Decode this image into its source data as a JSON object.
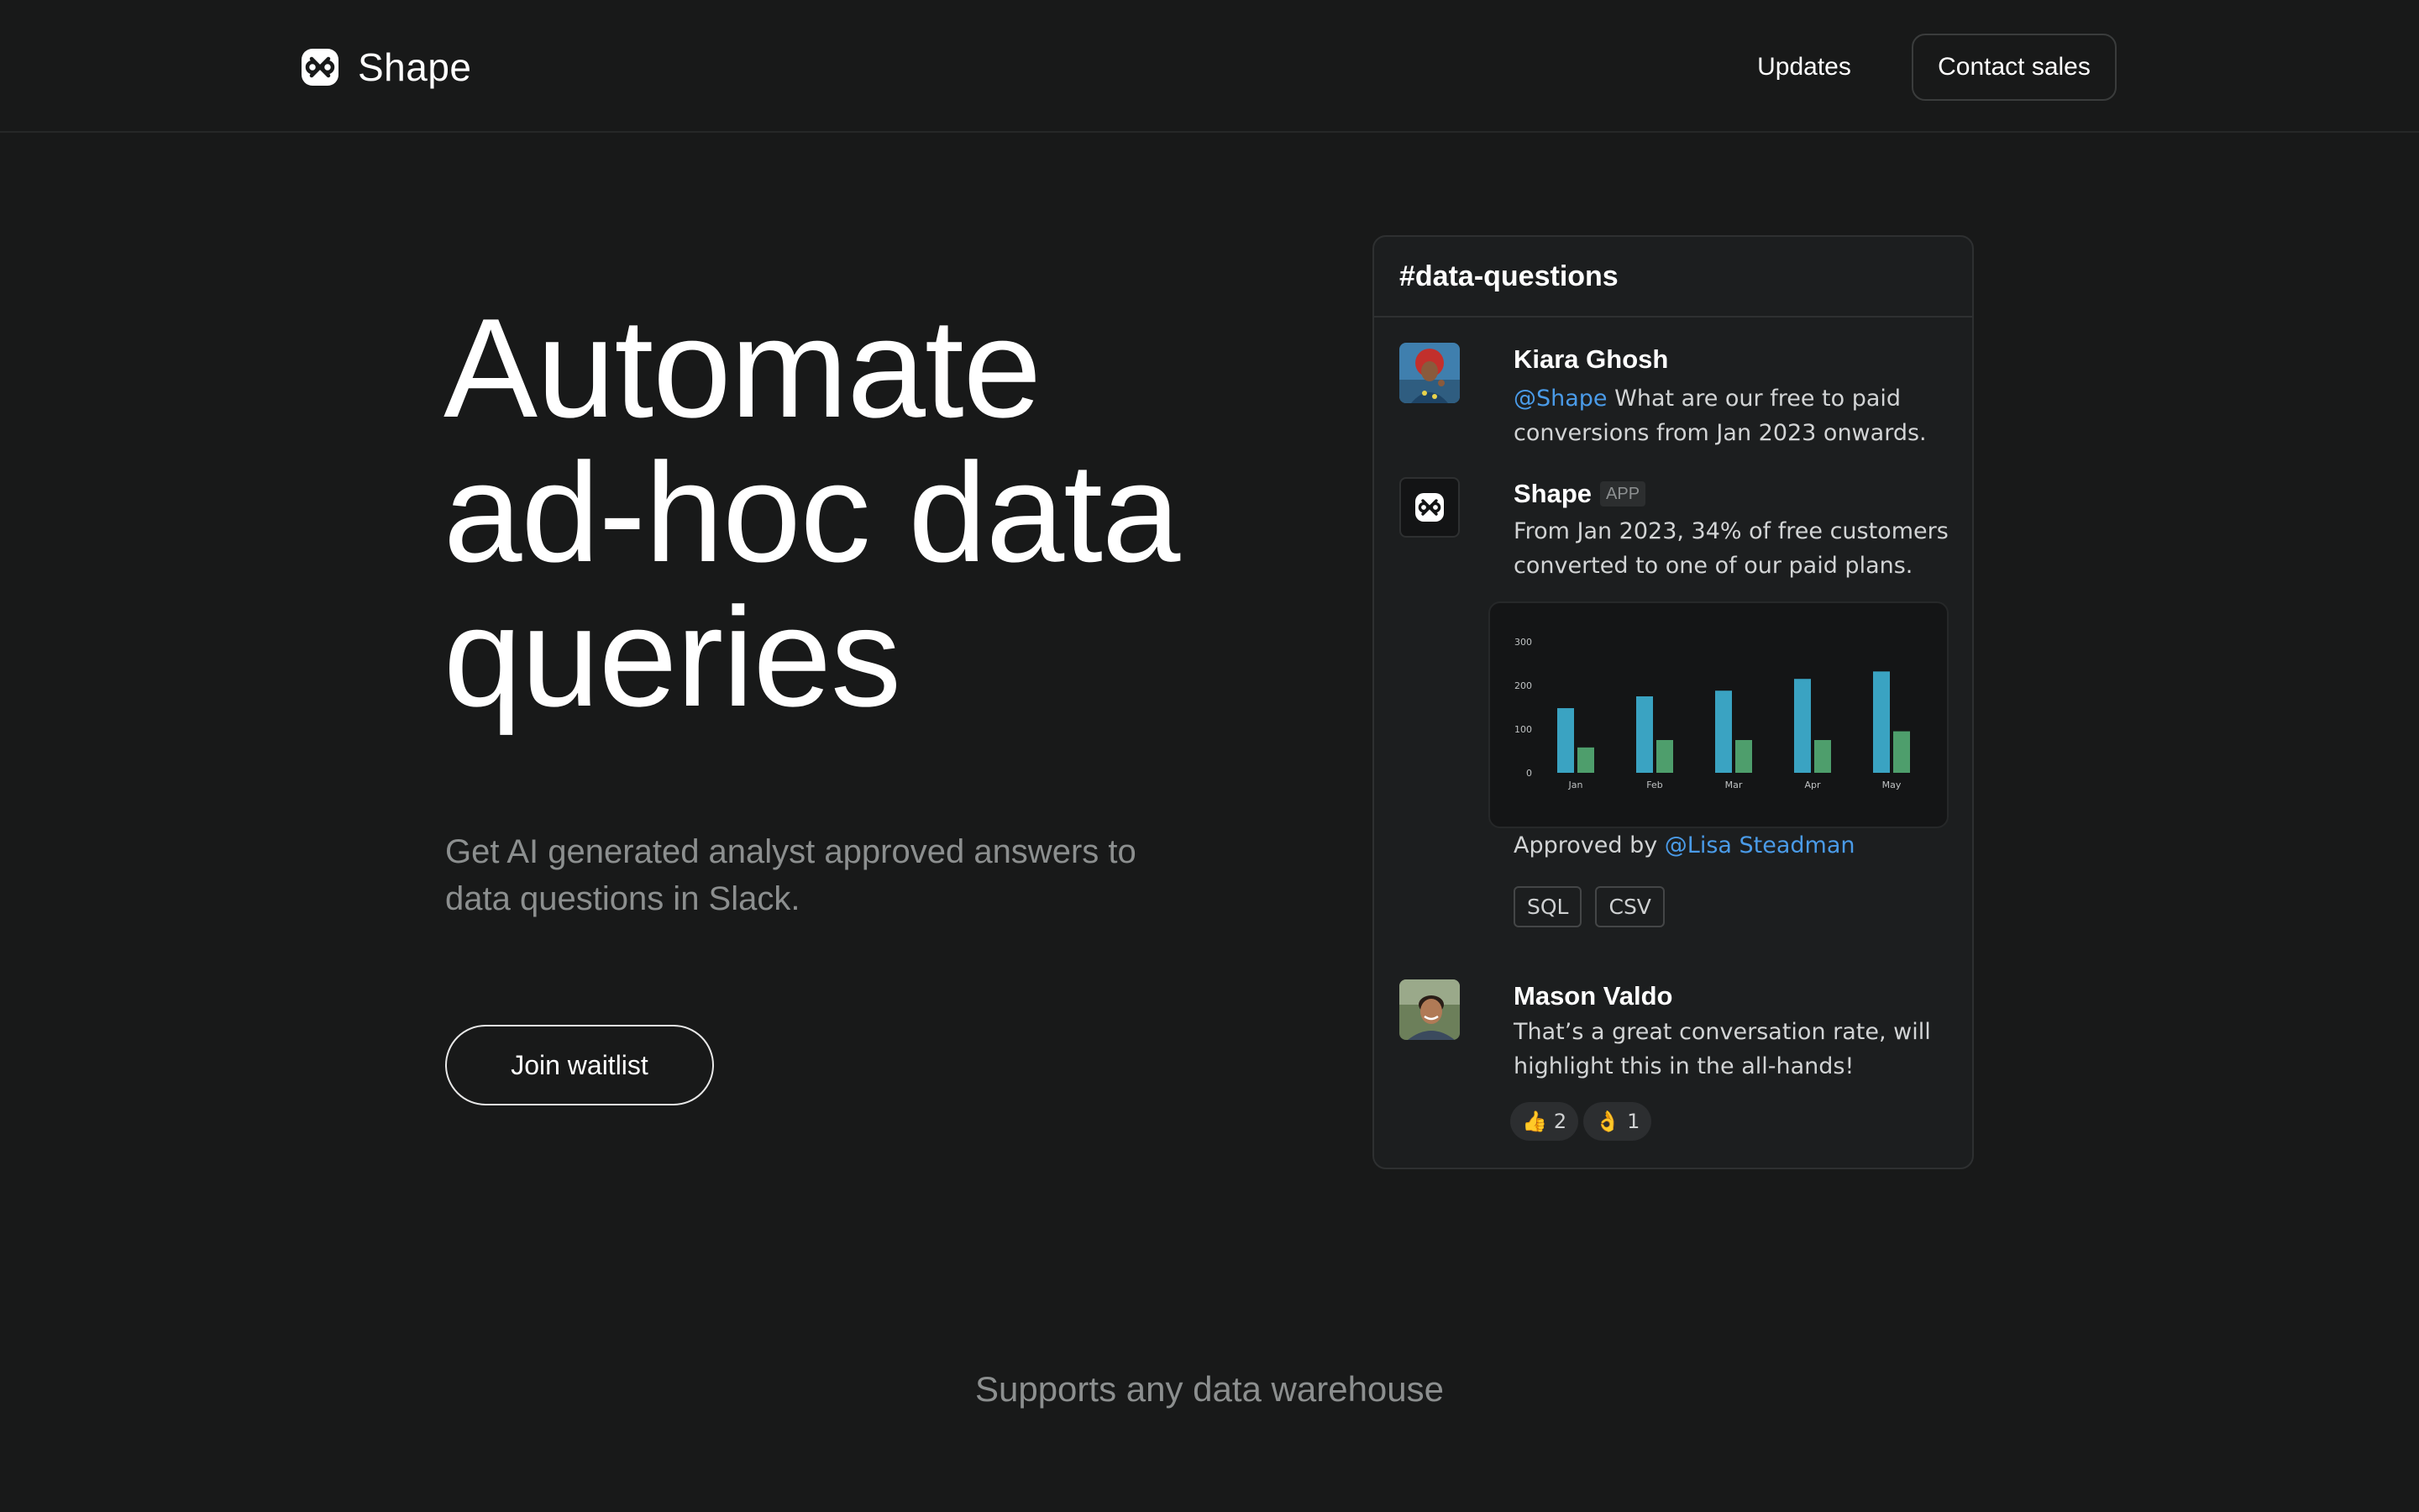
{
  "nav": {
    "brand": "Shape",
    "links": {
      "updates": "Updates"
    },
    "contact_label": "Contact sales"
  },
  "hero": {
    "title_lines": [
      "Automate",
      "ad-hoc data",
      "queries"
    ],
    "subtitle_lines": [
      "Get AI generated analyst approved answers to",
      "data questions in Slack."
    ],
    "cta_label": "Join waitlist"
  },
  "panel": {
    "channel": "#data-questions",
    "messages": [
      {
        "author": "Kiara Ghosh",
        "mention": "@Shape",
        "text_line1": " What are our free to paid",
        "text_line2": "conversions from Jan 2023 onwards."
      },
      {
        "author": "Shape",
        "badge": "APP",
        "text_line1": "From Jan 2023, 34% of free customers",
        "text_line2": "converted to one of our paid plans.",
        "approved_prefix": "Approved by ",
        "approved_mention": "@Lisa Steadman",
        "chips": [
          "SQL",
          "CSV"
        ]
      },
      {
        "author": "Mason Valdo",
        "text_line1": "That’s a great conversation rate, will",
        "text_line2": "highlight this in the all-hands!",
        "reactions": [
          {
            "emoji": "👍",
            "count": "2"
          },
          {
            "emoji": "👌",
            "count": "1"
          }
        ]
      }
    ]
  },
  "chart_data": {
    "type": "bar",
    "categories": [
      "Jan",
      "Feb",
      "Mar",
      "Apr",
      "May"
    ],
    "series": [
      {
        "values": [
          148,
          175,
          188,
          215,
          232
        ],
        "color": "#3aa3c2"
      },
      {
        "values": [
          58,
          75,
          75,
          75,
          95
        ],
        "color": "#4e9e6c"
      }
    ],
    "yticks": [
      "0",
      "100",
      "200",
      "300"
    ],
    "ylim": [
      0,
      300
    ]
  },
  "footer": {
    "tagline": "Supports any data warehouse"
  },
  "colors": {
    "background": "#181919",
    "mention": "#4a9be8",
    "muted_text": "#8c8f8f"
  }
}
